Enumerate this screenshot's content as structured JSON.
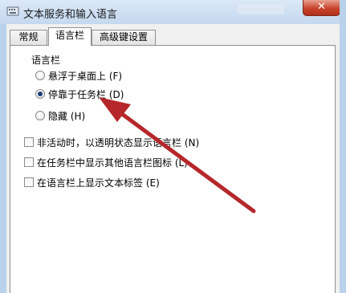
{
  "window": {
    "title": "文本服务和输入语言",
    "close_glyph": "✕"
  },
  "tabs": [
    {
      "label": "常规",
      "active": false
    },
    {
      "label": "语言栏",
      "active": true
    },
    {
      "label": "高级键设置",
      "active": false
    }
  ],
  "language_bar_group": {
    "label": "语言栏",
    "options": [
      {
        "label": "悬浮于桌面上 (F)",
        "selected": false
      },
      {
        "label": "停靠于任务栏 (D)",
        "selected": true
      },
      {
        "label": "隐藏 (H)",
        "selected": false
      }
    ]
  },
  "checkboxes": [
    {
      "label": "非活动时，以透明状态显示语言栏 (N)",
      "checked": false
    },
    {
      "label": "在任务栏中显示其他语言栏图标 (L)",
      "checked": false
    },
    {
      "label": "在语言栏上显示文本标签 (E)",
      "checked": false
    }
  ],
  "annotation": {
    "arrow_color": "#b5272a",
    "points_to": "停靠于任务栏 (D)"
  },
  "colors": {
    "frame": "#b9d1ea",
    "close_button": "#c8432c",
    "dialog_bg": "#f0f0f0"
  }
}
